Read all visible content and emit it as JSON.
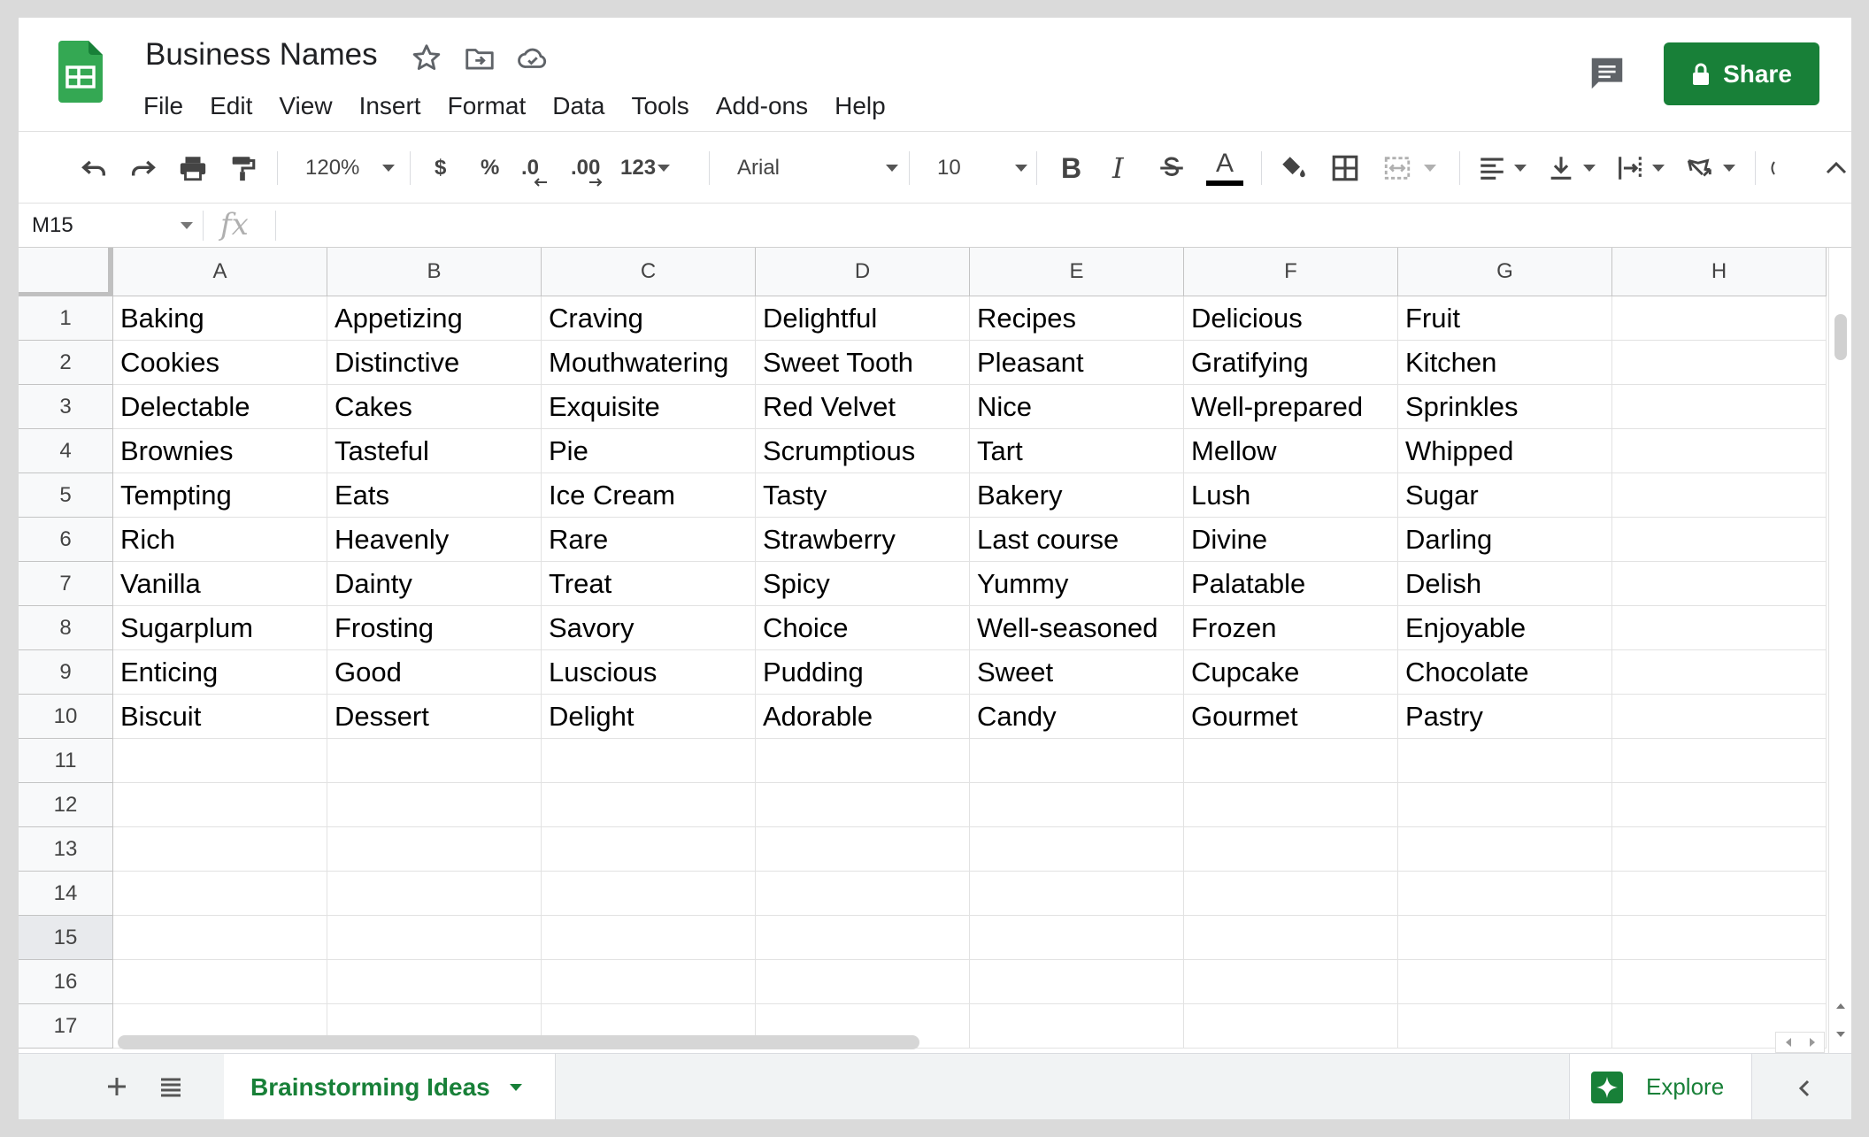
{
  "document": {
    "title": "Business Names"
  },
  "menu": [
    "File",
    "Edit",
    "View",
    "Insert",
    "Format",
    "Data",
    "Tools",
    "Add-ons",
    "Help"
  ],
  "share_button": {
    "label": "Share"
  },
  "toolbar": {
    "zoom": "120%",
    "currency": "$",
    "percent": "%",
    "decrease_decimal": ".0",
    "increase_decimal": ".00",
    "more_formats": "123",
    "font": "Arial",
    "font_size": "10",
    "bold": "B",
    "italic": "I",
    "text_color_glyph": "A"
  },
  "formula_bar": {
    "name_box": "M15",
    "fx": "fx"
  },
  "columns": [
    "A",
    "B",
    "C",
    "D",
    "E",
    "F",
    "G",
    "H"
  ],
  "rows": [
    "1",
    "2",
    "3",
    "4",
    "5",
    "6",
    "7",
    "8",
    "9",
    "10",
    "11",
    "12",
    "13",
    "14",
    "15",
    "16",
    "17"
  ],
  "selected_row": "15",
  "cells": [
    [
      "Baking",
      "Appetizing",
      "Craving",
      "Delightful",
      "Recipes",
      "Delicious",
      "Fruit",
      ""
    ],
    [
      "Cookies",
      "Distinctive",
      "Mouthwatering",
      "Sweet Tooth",
      "Pleasant",
      "Gratifying",
      "Kitchen",
      ""
    ],
    [
      "Delectable",
      "Cakes",
      "Exquisite",
      "Red Velvet",
      "Nice",
      "Well-prepared",
      "Sprinkles",
      ""
    ],
    [
      "Brownies",
      "Tasteful",
      "Pie",
      "Scrumptious",
      "Tart",
      "Mellow",
      "Whipped",
      ""
    ],
    [
      "Tempting",
      "Eats",
      "Ice Cream",
      "Tasty",
      "Bakery",
      "Lush",
      "Sugar",
      ""
    ],
    [
      "Rich",
      "Heavenly",
      "Rare",
      "Strawberry",
      "Last course",
      "Divine",
      "Darling",
      ""
    ],
    [
      "Vanilla",
      "Dainty",
      "Treat",
      "Spicy",
      "Yummy",
      "Palatable",
      "Delish",
      ""
    ],
    [
      "Sugarplum",
      "Frosting",
      "Savory",
      "Choice",
      "Well-seasoned",
      "Frozen",
      "Enjoyable",
      ""
    ],
    [
      "Enticing",
      "Good",
      "Luscious",
      "Pudding",
      "Sweet",
      "Cupcake",
      "Chocolate",
      ""
    ],
    [
      "Biscuit",
      "Dessert",
      "Delight",
      "Adorable",
      "Candy",
      "Gourmet",
      "Pastry",
      ""
    ]
  ],
  "sheet_tab": {
    "label": "Brainstorming Ideas"
  },
  "explore": {
    "label": "Explore"
  },
  "colors": {
    "brand_green": "#188038",
    "logo_green": "#34a853"
  }
}
